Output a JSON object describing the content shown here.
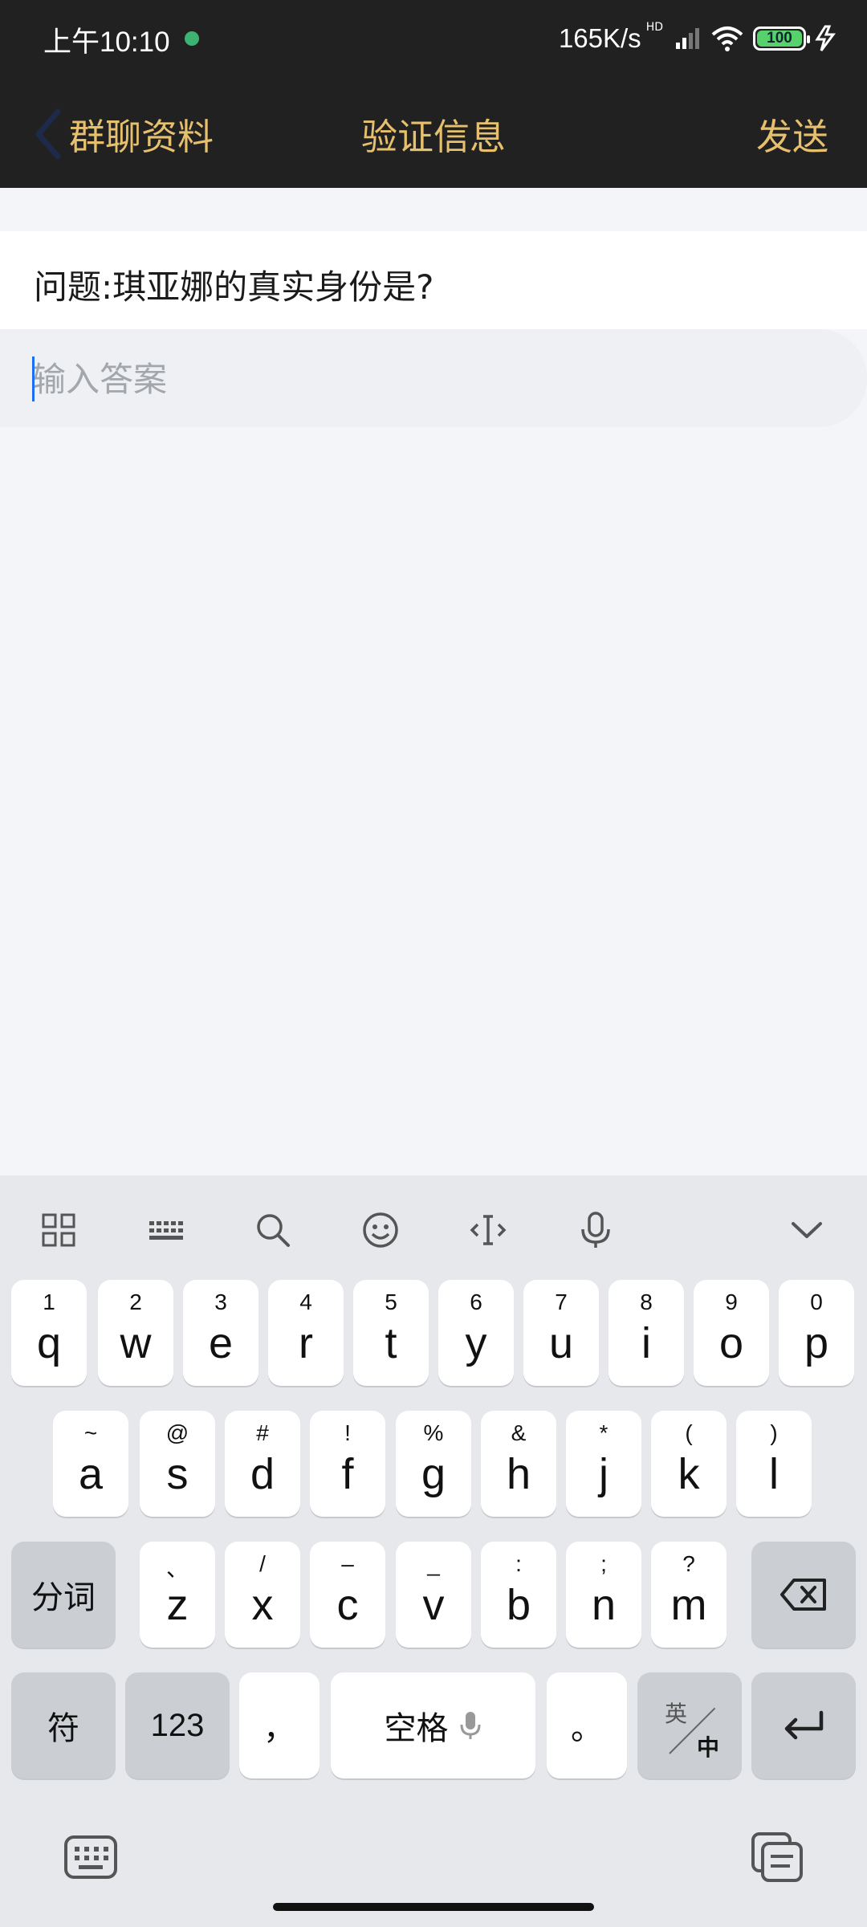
{
  "status_bar": {
    "time": "上午10:10",
    "speed": "165K/s",
    "hd_badge": "HD",
    "battery": "100"
  },
  "nav": {
    "back_label": "群聊资料",
    "title": "验证信息",
    "send_label": "发送"
  },
  "question": {
    "text": "问题:琪亚娜的真实身份是?"
  },
  "answer": {
    "value": "",
    "placeholder": "输入答案"
  },
  "keyboard": {
    "toolbar_icons": [
      "grid-icon",
      "keyboard-layout-icon",
      "search-icon",
      "emoji-icon",
      "cursor-icon",
      "microphone-icon",
      "collapse-chevron-icon"
    ],
    "row1": [
      {
        "main": "q",
        "sub": "1"
      },
      {
        "main": "w",
        "sub": "2"
      },
      {
        "main": "e",
        "sub": "3"
      },
      {
        "main": "r",
        "sub": "4"
      },
      {
        "main": "t",
        "sub": "5"
      },
      {
        "main": "y",
        "sub": "6"
      },
      {
        "main": "u",
        "sub": "7"
      },
      {
        "main": "i",
        "sub": "8"
      },
      {
        "main": "o",
        "sub": "9"
      },
      {
        "main": "p",
        "sub": "0"
      }
    ],
    "row2": [
      {
        "main": "a",
        "sub": "~"
      },
      {
        "main": "s",
        "sub": "@"
      },
      {
        "main": "d",
        "sub": "#"
      },
      {
        "main": "f",
        "sub": "!"
      },
      {
        "main": "g",
        "sub": "%"
      },
      {
        "main": "h",
        "sub": "&"
      },
      {
        "main": "j",
        "sub": "*"
      },
      {
        "main": "k",
        "sub": "("
      },
      {
        "main": "l",
        "sub": ")"
      }
    ],
    "row3": [
      {
        "main": "z",
        "sub": "、"
      },
      {
        "main": "x",
        "sub": "/"
      },
      {
        "main": "c",
        "sub": "–"
      },
      {
        "main": "v",
        "sub": "_"
      },
      {
        "main": "b",
        "sub": ":"
      },
      {
        "main": "n",
        "sub": ";"
      },
      {
        "main": "m",
        "sub": "?"
      }
    ],
    "segment_label": "分词",
    "symbols_label": "符",
    "numbers_label": "123",
    "comma_label": "，",
    "space_label": "空格",
    "period_label": "。",
    "switch_en": "英",
    "switch_zh": "中"
  }
}
